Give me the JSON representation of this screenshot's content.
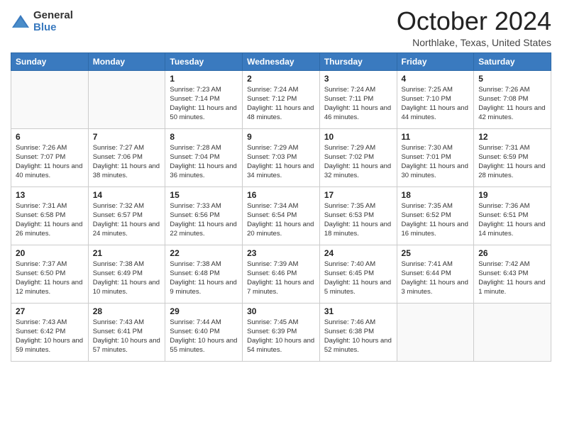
{
  "logo": {
    "general": "General",
    "blue": "Blue"
  },
  "header": {
    "month": "October 2024",
    "location": "Northlake, Texas, United States"
  },
  "days_of_week": [
    "Sunday",
    "Monday",
    "Tuesday",
    "Wednesday",
    "Thursday",
    "Friday",
    "Saturday"
  ],
  "weeks": [
    [
      {
        "day": "",
        "sunrise": "",
        "sunset": "",
        "daylight": ""
      },
      {
        "day": "",
        "sunrise": "",
        "sunset": "",
        "daylight": ""
      },
      {
        "day": "1",
        "sunrise": "Sunrise: 7:23 AM",
        "sunset": "Sunset: 7:14 PM",
        "daylight": "Daylight: 11 hours and 50 minutes."
      },
      {
        "day": "2",
        "sunrise": "Sunrise: 7:24 AM",
        "sunset": "Sunset: 7:12 PM",
        "daylight": "Daylight: 11 hours and 48 minutes."
      },
      {
        "day": "3",
        "sunrise": "Sunrise: 7:24 AM",
        "sunset": "Sunset: 7:11 PM",
        "daylight": "Daylight: 11 hours and 46 minutes."
      },
      {
        "day": "4",
        "sunrise": "Sunrise: 7:25 AM",
        "sunset": "Sunset: 7:10 PM",
        "daylight": "Daylight: 11 hours and 44 minutes."
      },
      {
        "day": "5",
        "sunrise": "Sunrise: 7:26 AM",
        "sunset": "Sunset: 7:08 PM",
        "daylight": "Daylight: 11 hours and 42 minutes."
      }
    ],
    [
      {
        "day": "6",
        "sunrise": "Sunrise: 7:26 AM",
        "sunset": "Sunset: 7:07 PM",
        "daylight": "Daylight: 11 hours and 40 minutes."
      },
      {
        "day": "7",
        "sunrise": "Sunrise: 7:27 AM",
        "sunset": "Sunset: 7:06 PM",
        "daylight": "Daylight: 11 hours and 38 minutes."
      },
      {
        "day": "8",
        "sunrise": "Sunrise: 7:28 AM",
        "sunset": "Sunset: 7:04 PM",
        "daylight": "Daylight: 11 hours and 36 minutes."
      },
      {
        "day": "9",
        "sunrise": "Sunrise: 7:29 AM",
        "sunset": "Sunset: 7:03 PM",
        "daylight": "Daylight: 11 hours and 34 minutes."
      },
      {
        "day": "10",
        "sunrise": "Sunrise: 7:29 AM",
        "sunset": "Sunset: 7:02 PM",
        "daylight": "Daylight: 11 hours and 32 minutes."
      },
      {
        "day": "11",
        "sunrise": "Sunrise: 7:30 AM",
        "sunset": "Sunset: 7:01 PM",
        "daylight": "Daylight: 11 hours and 30 minutes."
      },
      {
        "day": "12",
        "sunrise": "Sunrise: 7:31 AM",
        "sunset": "Sunset: 6:59 PM",
        "daylight": "Daylight: 11 hours and 28 minutes."
      }
    ],
    [
      {
        "day": "13",
        "sunrise": "Sunrise: 7:31 AM",
        "sunset": "Sunset: 6:58 PM",
        "daylight": "Daylight: 11 hours and 26 minutes."
      },
      {
        "day": "14",
        "sunrise": "Sunrise: 7:32 AM",
        "sunset": "Sunset: 6:57 PM",
        "daylight": "Daylight: 11 hours and 24 minutes."
      },
      {
        "day": "15",
        "sunrise": "Sunrise: 7:33 AM",
        "sunset": "Sunset: 6:56 PM",
        "daylight": "Daylight: 11 hours and 22 minutes."
      },
      {
        "day": "16",
        "sunrise": "Sunrise: 7:34 AM",
        "sunset": "Sunset: 6:54 PM",
        "daylight": "Daylight: 11 hours and 20 minutes."
      },
      {
        "day": "17",
        "sunrise": "Sunrise: 7:35 AM",
        "sunset": "Sunset: 6:53 PM",
        "daylight": "Daylight: 11 hours and 18 minutes."
      },
      {
        "day": "18",
        "sunrise": "Sunrise: 7:35 AM",
        "sunset": "Sunset: 6:52 PM",
        "daylight": "Daylight: 11 hours and 16 minutes."
      },
      {
        "day": "19",
        "sunrise": "Sunrise: 7:36 AM",
        "sunset": "Sunset: 6:51 PM",
        "daylight": "Daylight: 11 hours and 14 minutes."
      }
    ],
    [
      {
        "day": "20",
        "sunrise": "Sunrise: 7:37 AM",
        "sunset": "Sunset: 6:50 PM",
        "daylight": "Daylight: 11 hours and 12 minutes."
      },
      {
        "day": "21",
        "sunrise": "Sunrise: 7:38 AM",
        "sunset": "Sunset: 6:49 PM",
        "daylight": "Daylight: 11 hours and 10 minutes."
      },
      {
        "day": "22",
        "sunrise": "Sunrise: 7:38 AM",
        "sunset": "Sunset: 6:48 PM",
        "daylight": "Daylight: 11 hours and 9 minutes."
      },
      {
        "day": "23",
        "sunrise": "Sunrise: 7:39 AM",
        "sunset": "Sunset: 6:46 PM",
        "daylight": "Daylight: 11 hours and 7 minutes."
      },
      {
        "day": "24",
        "sunrise": "Sunrise: 7:40 AM",
        "sunset": "Sunset: 6:45 PM",
        "daylight": "Daylight: 11 hours and 5 minutes."
      },
      {
        "day": "25",
        "sunrise": "Sunrise: 7:41 AM",
        "sunset": "Sunset: 6:44 PM",
        "daylight": "Daylight: 11 hours and 3 minutes."
      },
      {
        "day": "26",
        "sunrise": "Sunrise: 7:42 AM",
        "sunset": "Sunset: 6:43 PM",
        "daylight": "Daylight: 11 hours and 1 minute."
      }
    ],
    [
      {
        "day": "27",
        "sunrise": "Sunrise: 7:43 AM",
        "sunset": "Sunset: 6:42 PM",
        "daylight": "Daylight: 10 hours and 59 minutes."
      },
      {
        "day": "28",
        "sunrise": "Sunrise: 7:43 AM",
        "sunset": "Sunset: 6:41 PM",
        "daylight": "Daylight: 10 hours and 57 minutes."
      },
      {
        "day": "29",
        "sunrise": "Sunrise: 7:44 AM",
        "sunset": "Sunset: 6:40 PM",
        "daylight": "Daylight: 10 hours and 55 minutes."
      },
      {
        "day": "30",
        "sunrise": "Sunrise: 7:45 AM",
        "sunset": "Sunset: 6:39 PM",
        "daylight": "Daylight: 10 hours and 54 minutes."
      },
      {
        "day": "31",
        "sunrise": "Sunrise: 7:46 AM",
        "sunset": "Sunset: 6:38 PM",
        "daylight": "Daylight: 10 hours and 52 minutes."
      },
      {
        "day": "",
        "sunrise": "",
        "sunset": "",
        "daylight": ""
      },
      {
        "day": "",
        "sunrise": "",
        "sunset": "",
        "daylight": ""
      }
    ]
  ]
}
